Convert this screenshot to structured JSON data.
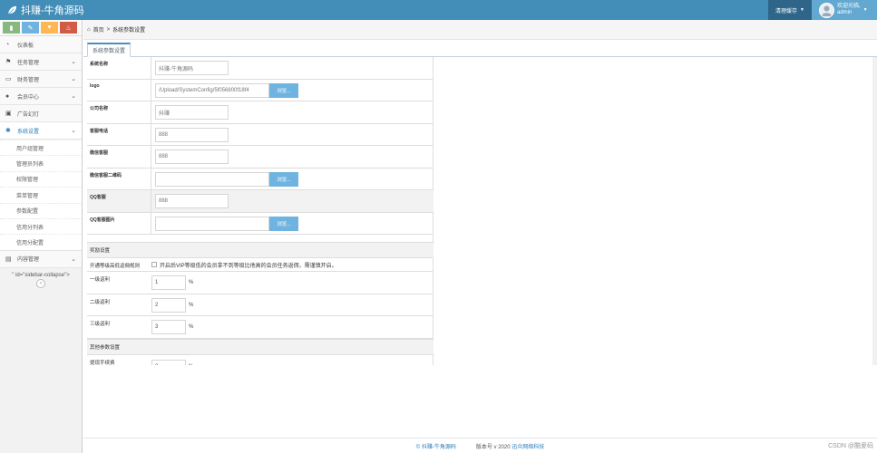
{
  "app": {
    "brand": "抖赚-牛角源码"
  },
  "navbar": {
    "clear_cache": "清理缓存",
    "user_greeting": "欢迎光临,",
    "user_name": "admin"
  },
  "sidebar": {
    "items": [
      {
        "label": "仪表板",
        "icon": "dashboard-icon"
      },
      {
        "label": "任务管理",
        "icon": "flag-icon"
      },
      {
        "label": "财务管理",
        "icon": "wallet-icon"
      },
      {
        "label": "会员中心",
        "icon": "user-icon"
      },
      {
        "label": "广告幻灯",
        "icon": "picture-icon"
      },
      {
        "label": "系统设置",
        "icon": "gear-icon"
      }
    ],
    "submenu": [
      {
        "label": "用户组管理"
      },
      {
        "label": "管理员列表"
      },
      {
        "label": "权限管理"
      },
      {
        "label": "菜单管理"
      },
      {
        "label": "参数配置"
      },
      {
        "label": "信用分列表"
      },
      {
        "label": "信用分配置"
      }
    ],
    "content_menu": {
      "label": "内容管理",
      "icon": "book-icon"
    },
    "stray_text": "\" id=\"sidebar-collapse\">"
  },
  "breadcrumbs": {
    "home": "首页",
    "separator": ">",
    "current": "系统参数设置"
  },
  "tab": {
    "label": "系统参数设置"
  },
  "form": {
    "browse_label": "浏览...",
    "rows": [
      {
        "label": "系统名称",
        "value": "抖赚-牛角源码"
      },
      {
        "label": "logo",
        "value": "/Upload/SystemConfig/5f056800f18f4"
      },
      {
        "label": "公司名称",
        "value": "抖赚"
      },
      {
        "label": "客服电话",
        "value": "888"
      },
      {
        "label": "微信客服",
        "value": "888"
      },
      {
        "label": "微信客服二维码",
        "value": ""
      },
      {
        "label": "QQ客服",
        "value": "888"
      },
      {
        "label": "QQ客服图片",
        "value": ""
      }
    ]
  },
  "reward_section": {
    "title": "奖励设置",
    "rule_label": "开通等级高低返佣规则",
    "rule_text": "开启后VIP等级低的会员拿不到等级比他高的会员任务返佣，需谨慎开启。",
    "levels": [
      {
        "label": "一级返利",
        "value": "1",
        "unit": "%"
      },
      {
        "label": "二级返利",
        "value": "2",
        "unit": "%"
      },
      {
        "label": "三级返利",
        "value": "3",
        "unit": "%"
      }
    ]
  },
  "other_section": {
    "title": "其他参数设置",
    "fee_label": "提现手续费",
    "fee_value": "2",
    "fee_unit": "%"
  },
  "footer": {
    "copyright_symbol": "©",
    "brand": "抖赚-牛角源码",
    "version": "版本号 v 2020",
    "company": "迅众网络科技"
  },
  "watermark": "CSDN @酷爱码"
}
